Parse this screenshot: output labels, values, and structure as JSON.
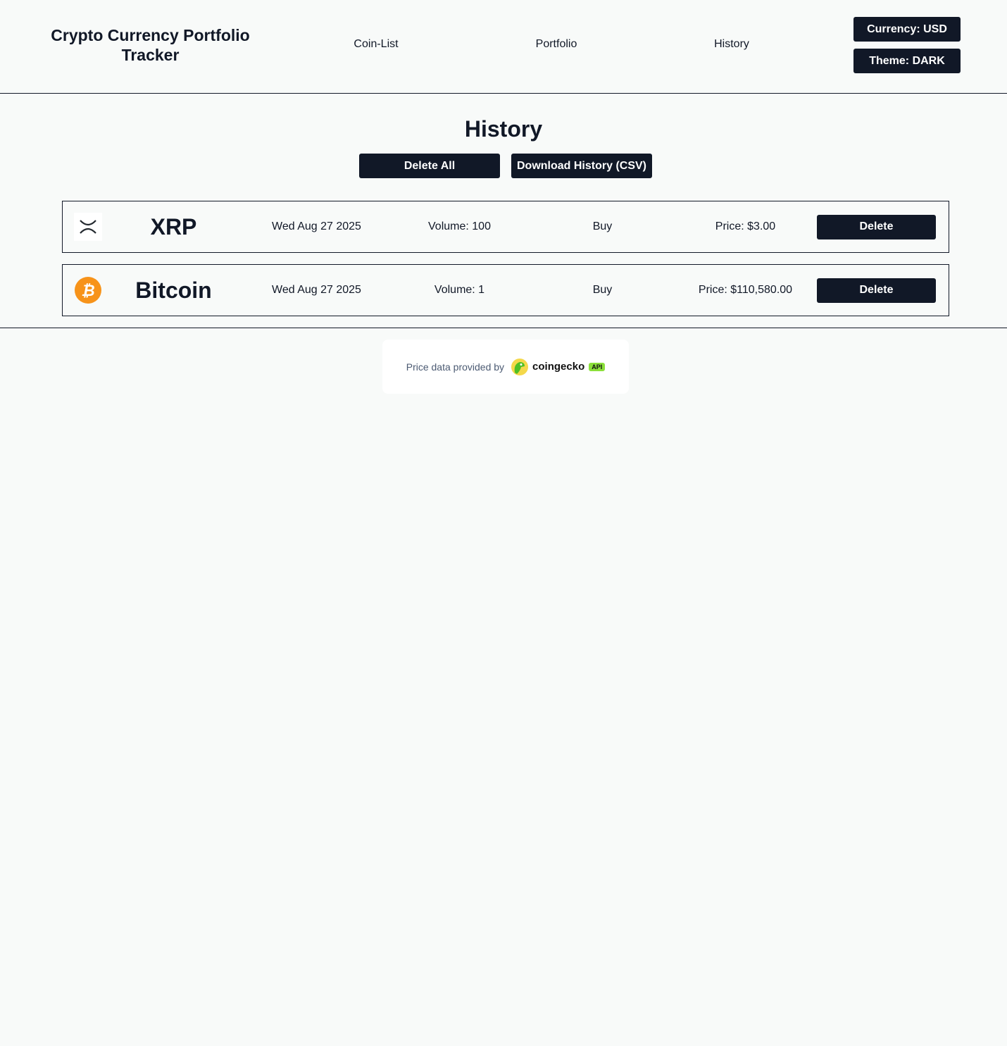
{
  "header": {
    "title": "Crypto Currency Portfolio Tracker",
    "nav": [
      "Coin-List",
      "Portfolio",
      "History"
    ],
    "currency_button": "Currency: USD",
    "theme_button": "Theme: DARK"
  },
  "page": {
    "title": "History",
    "delete_all": "Delete All",
    "download": "Download History (CSV)"
  },
  "history": [
    {
      "icon": "xrp-icon",
      "name": "XRP",
      "date": "Wed Aug 27 2025",
      "volume": "Volume: 100",
      "type": "Buy",
      "price": "Price: $3.00",
      "delete": "Delete"
    },
    {
      "icon": "bitcoin-icon",
      "name": "Bitcoin",
      "date": "Wed Aug 27 2025",
      "volume": "Volume: 1",
      "type": "Buy",
      "price": "Price: $110,580.00",
      "delete": "Delete"
    }
  ],
  "footer": {
    "text": "Price data provided by",
    "brand": "coingecko",
    "badge": "API",
    "colors": {
      "badge": "#8bdf3a",
      "bitcoin": "#f7931a"
    }
  }
}
